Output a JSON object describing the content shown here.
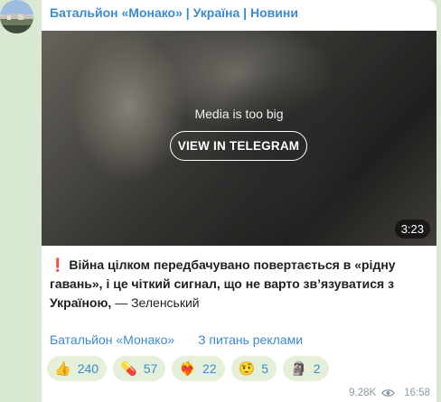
{
  "channel": {
    "name": "Батальйон «Монако» | Україна | Новини"
  },
  "media": {
    "notice": "Media is too big",
    "button_label": "VIEW IN TELEGRAM",
    "duration": "3:23"
  },
  "message": {
    "emoji": "❗",
    "bold_text": "Війна цілком передбачувано повертається в «рідну гавань», і це чіткий сигнал, що не варто зв’язуватися з Україною,",
    "plain_text": " — Зеленський"
  },
  "links": {
    "channel_link": "Батальйон «Монако»",
    "ads_link": "З питань реклами"
  },
  "reactions": [
    {
      "emoji": "👍",
      "count": "240"
    },
    {
      "emoji": "💊",
      "count": "57"
    },
    {
      "emoji": "❤‍🔥",
      "count": "22"
    },
    {
      "emoji": "🤨",
      "count": "5"
    },
    {
      "emoji": "🗿",
      "count": "2"
    }
  ],
  "meta": {
    "views": "9.28K",
    "time": "16:58"
  },
  "colors": {
    "accent": "#3a8bd1",
    "background": "#d9e8d0",
    "reaction_bg": "#e4f0da"
  }
}
